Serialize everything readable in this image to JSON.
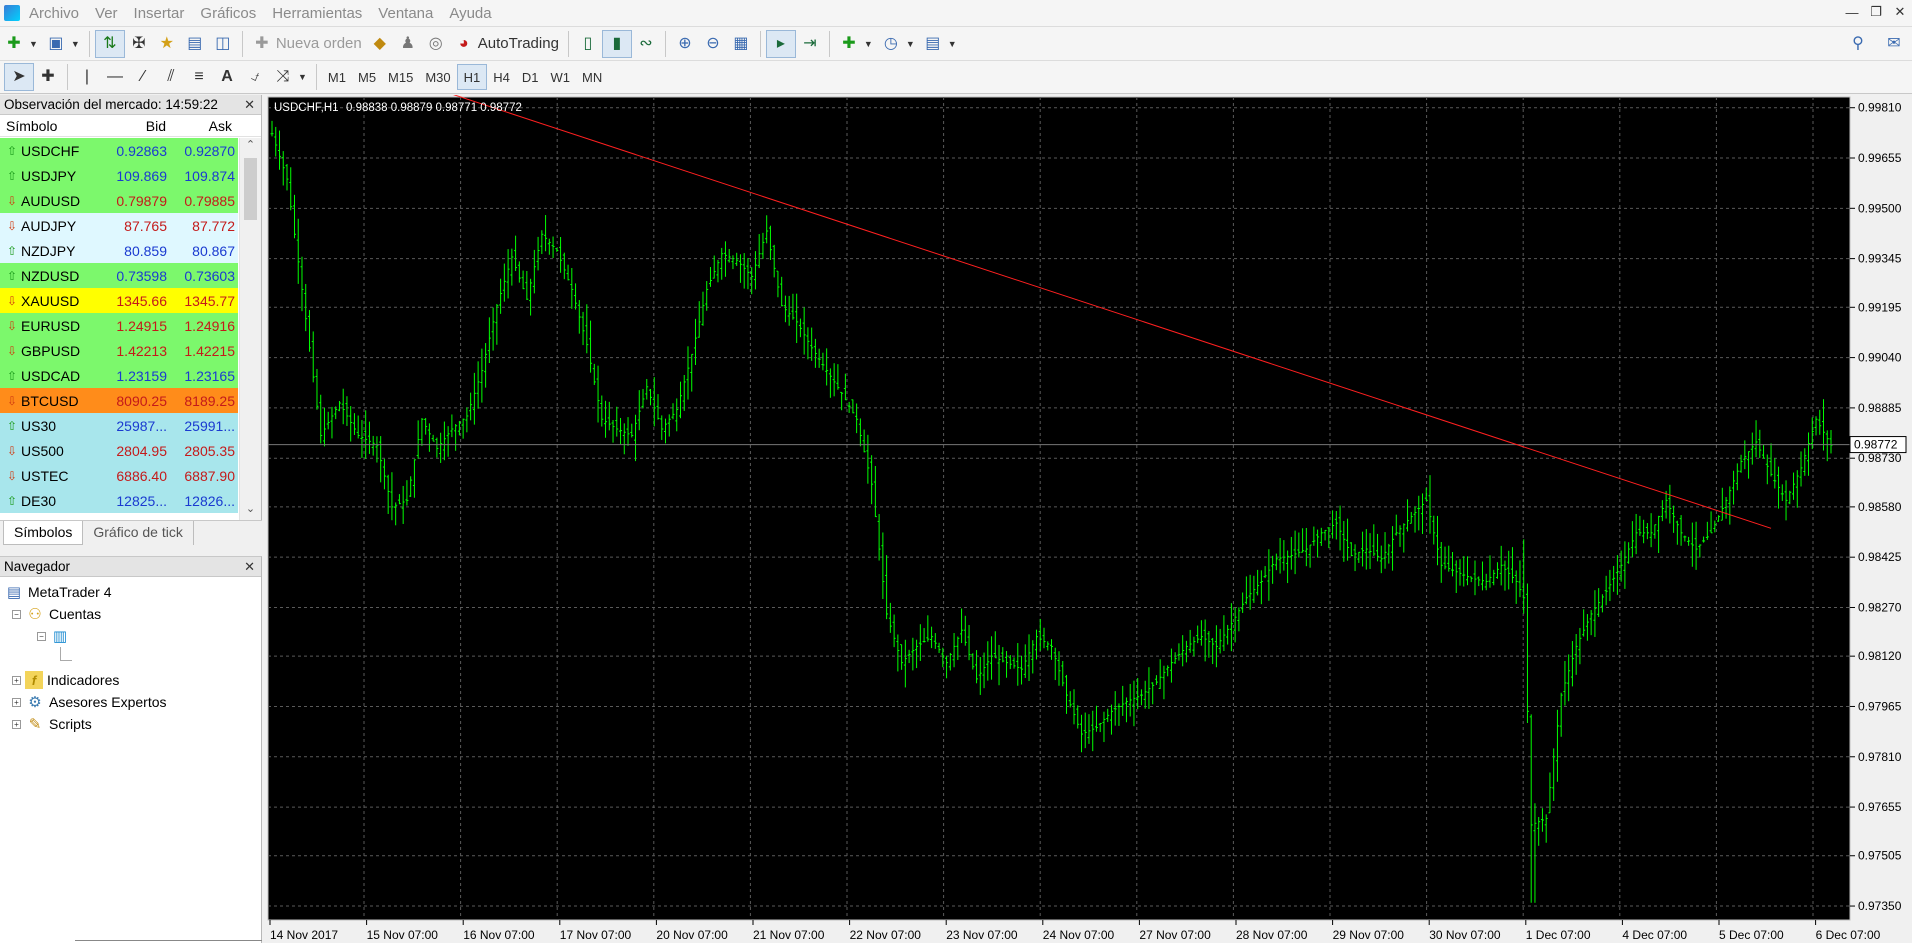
{
  "menu": [
    "Archivo",
    "Ver",
    "Insertar",
    "Gráficos",
    "Herramientas",
    "Ventana",
    "Ayuda"
  ],
  "toolbar": {
    "new_order": "Nueva orden",
    "autotrading": "AutoTrading"
  },
  "timeframes": [
    "M1",
    "M5",
    "M15",
    "M30",
    "H1",
    "H4",
    "D1",
    "W1",
    "MN"
  ],
  "active_timeframe": "H1",
  "market_watch": {
    "title": "Observación del mercado: 14:59:22",
    "col_symbol": "Símbolo",
    "col_bid": "Bid",
    "col_ask": "Ask",
    "rows": [
      {
        "symbol": "USDCHF",
        "bid": "0.92863",
        "ask": "0.92870",
        "dir": "up",
        "bg": "#7cf86c",
        "color": "blue"
      },
      {
        "symbol": "USDJPY",
        "bid": "109.869",
        "ask": "109.874",
        "dir": "up",
        "bg": "#7cf86c",
        "color": "blue"
      },
      {
        "symbol": "AUDUSD",
        "bid": "0.79879",
        "ask": "0.79885",
        "dir": "down",
        "bg": "#7cf86c",
        "color": "red"
      },
      {
        "symbol": "AUDJPY",
        "bid": "87.765",
        "ask": "87.772",
        "dir": "down",
        "bg": "#dff8ff",
        "color": "red"
      },
      {
        "symbol": "NZDJPY",
        "bid": "80.859",
        "ask": "80.867",
        "dir": "up",
        "bg": "#dff8ff",
        "color": "blue"
      },
      {
        "symbol": "NZDUSD",
        "bid": "0.73598",
        "ask": "0.73603",
        "dir": "up",
        "bg": "#7cf86c",
        "color": "blue"
      },
      {
        "symbol": "XAUUSD",
        "bid": "1345.66",
        "ask": "1345.77",
        "dir": "down",
        "bg": "#ffff00",
        "color": "red"
      },
      {
        "symbol": "EURUSD",
        "bid": "1.24915",
        "ask": "1.24916",
        "dir": "down",
        "bg": "#7cf86c",
        "color": "red"
      },
      {
        "symbol": "GBPUSD",
        "bid": "1.42213",
        "ask": "1.42215",
        "dir": "down",
        "bg": "#7cf86c",
        "color": "red"
      },
      {
        "symbol": "USDCAD",
        "bid": "1.23159",
        "ask": "1.23165",
        "dir": "up",
        "bg": "#7cf86c",
        "color": "blue"
      },
      {
        "symbol": "BTCUSD",
        "bid": "8090.25",
        "ask": "8189.25",
        "dir": "down",
        "bg": "#ff8c1a",
        "color": "red"
      },
      {
        "symbol": "US30",
        "bid": "25987...",
        "ask": "25991...",
        "dir": "up",
        "bg": "#a8e6ec",
        "color": "blue"
      },
      {
        "symbol": "US500",
        "bid": "2804.95",
        "ask": "2805.35",
        "dir": "down",
        "bg": "#a8e6ec",
        "color": "red"
      },
      {
        "symbol": "USTEC",
        "bid": "6886.40",
        "ask": "6887.90",
        "dir": "down",
        "bg": "#a8e6ec",
        "color": "red"
      },
      {
        "symbol": "DE30",
        "bid": "12825...",
        "ask": "12826...",
        "dir": "up",
        "bg": "#a8e6ec",
        "color": "blue"
      }
    ],
    "tabs": [
      "Símbolos",
      "Gráfico de tick"
    ]
  },
  "navigator": {
    "title": "Navegador",
    "root": "MetaTrader 4",
    "accounts": "Cuentas",
    "indicators": "Indicadores",
    "experts": "Asesores Expertos",
    "scripts": "Scripts"
  },
  "chart_data": {
    "type": "bar",
    "symbol_label": "USDCHF,H1",
    "ohlc_label": "0.98838 0.98879 0.98771 0.98772",
    "current_price": "0.98772",
    "y_ticks": [
      "0.99810",
      "0.99655",
      "0.99500",
      "0.99345",
      "0.99195",
      "0.99040",
      "0.98885",
      "0.98730",
      "0.98580",
      "0.98425",
      "0.98270",
      "0.98120",
      "0.97965",
      "0.97810",
      "0.97655",
      "0.97505",
      "0.97350"
    ],
    "x_ticks": [
      "14 Nov 2017",
      "15 Nov 07:00",
      "16 Nov 07:00",
      "17 Nov 07:00",
      "20 Nov 07:00",
      "21 Nov 07:00",
      "22 Nov 07:00",
      "23 Nov 07:00",
      "24 Nov 07:00",
      "27 Nov 07:00",
      "28 Nov 07:00",
      "29 Nov 07:00",
      "30 Nov 07:00",
      "1 Dec 07:00",
      "4 Dec 07:00",
      "5 Dec 07:00",
      "6 Dec 07:00"
    ],
    "ylim": [
      0.97307,
      0.99843
    ],
    "bar_color": "#00ff00",
    "trendline_color": "#ff2020",
    "trendline": {
      "from": {
        "bar": -12,
        "price": 1.0008
      },
      "to": {
        "bar": 400,
        "price": 0.98514
      }
    },
    "series_close_path": [
      [
        0,
        0.9973
      ],
      [
        4,
        0.9959
      ],
      [
        8,
        0.9925
      ],
      [
        13,
        0.988
      ],
      [
        18,
        0.989
      ],
      [
        23,
        0.988
      ],
      [
        28,
        0.9877
      ],
      [
        32,
        0.9858
      ],
      [
        36,
        0.986
      ],
      [
        40,
        0.9885
      ],
      [
        44,
        0.9876
      ],
      [
        48,
        0.9882
      ],
      [
        52,
        0.9886
      ],
      [
        56,
        0.99
      ],
      [
        60,
        0.992
      ],
      [
        64,
        0.9935
      ],
      [
        68,
        0.9922
      ],
      [
        72,
        0.9942
      ],
      [
        76,
        0.9937
      ],
      [
        80,
        0.9925
      ],
      [
        84,
        0.9908
      ],
      [
        88,
        0.9885
      ],
      [
        92,
        0.9882
      ],
      [
        96,
        0.988
      ],
      [
        100,
        0.9895
      ],
      [
        104,
        0.9882
      ],
      [
        108,
        0.9888
      ],
      [
        112,
        0.9905
      ],
      [
        116,
        0.9925
      ],
      [
        120,
        0.9936
      ],
      [
        124,
        0.9934
      ],
      [
        128,
        0.9929
      ],
      [
        132,
        0.9943
      ],
      [
        136,
        0.992
      ],
      [
        140,
        0.9915
      ],
      [
        144,
        0.9907
      ],
      [
        148,
        0.99
      ],
      [
        152,
        0.9893
      ],
      [
        156,
        0.9885
      ],
      [
        160,
        0.9865
      ],
      [
        164,
        0.9825
      ],
      [
        168,
        0.981
      ],
      [
        172,
        0.9815
      ],
      [
        176,
        0.9818
      ],
      [
        180,
        0.981
      ],
      [
        184,
        0.982
      ],
      [
        188,
        0.9805
      ],
      [
        192,
        0.9812
      ],
      [
        196,
        0.981
      ],
      [
        200,
        0.9808
      ],
      [
        204,
        0.9818
      ],
      [
        208,
        0.9815
      ],
      [
        212,
        0.98
      ],
      [
        216,
        0.9788
      ],
      [
        220,
        0.979
      ],
      [
        224,
        0.9795
      ],
      [
        228,
        0.9798
      ],
      [
        232,
        0.98
      ],
      [
        236,
        0.9804
      ],
      [
        240,
        0.981
      ],
      [
        244,
        0.9815
      ],
      [
        248,
        0.9818
      ],
      [
        252,
        0.9815
      ],
      [
        256,
        0.9822
      ],
      [
        260,
        0.983
      ],
      [
        264,
        0.9835
      ],
      [
        268,
        0.9842
      ],
      [
        272,
        0.9843
      ],
      [
        276,
        0.9845
      ],
      [
        280,
        0.985
      ],
      [
        284,
        0.9853
      ],
      [
        288,
        0.9843
      ],
      [
        292,
        0.9845
      ],
      [
        296,
        0.9842
      ],
      [
        300,
        0.985
      ],
      [
        304,
        0.9855
      ],
      [
        308,
        0.986
      ],
      [
        312,
        0.984
      ],
      [
        316,
        0.9838
      ],
      [
        320,
        0.9836
      ],
      [
        324,
        0.9835
      ],
      [
        328,
        0.984
      ],
      [
        332,
        0.9835
      ],
      [
        334,
        0.983
      ],
      [
        336,
        0.976
      ],
      [
        340,
        0.9762
      ],
      [
        344,
        0.98
      ],
      [
        348,
        0.9815
      ],
      [
        352,
        0.9825
      ],
      [
        356,
        0.9832
      ],
      [
        360,
        0.984
      ],
      [
        364,
        0.985
      ],
      [
        368,
        0.985
      ],
      [
        372,
        0.986
      ],
      [
        376,
        0.985
      ],
      [
        380,
        0.9845
      ],
      [
        384,
        0.985
      ],
      [
        388,
        0.986
      ],
      [
        392,
        0.9872
      ],
      [
        396,
        0.9878
      ],
      [
        400,
        0.9868
      ],
      [
        404,
        0.986
      ],
      [
        408,
        0.987
      ],
      [
        412,
        0.9885
      ],
      [
        416,
        0.9877
      ]
    ]
  }
}
